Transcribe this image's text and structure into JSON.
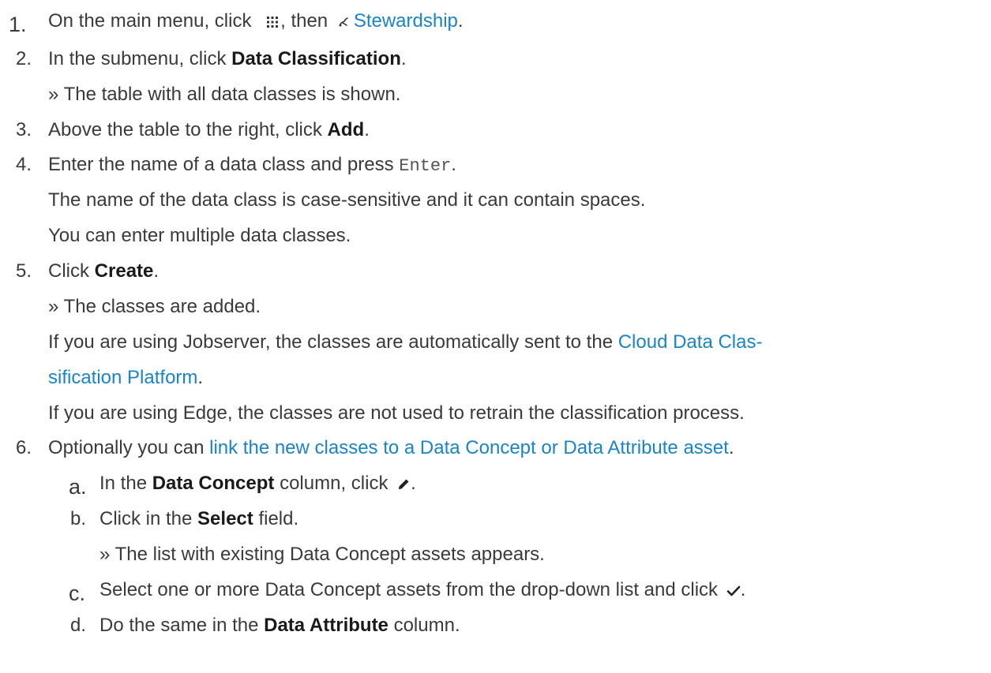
{
  "icons": {
    "menu": "grid-menu-icon",
    "stewardship": "stewardship-icon",
    "edit": "pencil-icon",
    "confirm": "checkmark-icon"
  },
  "colors": {
    "text": "#3a3a3a",
    "link": "#1a84c6"
  },
  "steps": {
    "s1": {
      "num": "1.",
      "t1": "On the main menu, click",
      "t2": ", then",
      "link": "Stewardship",
      "t3": "."
    },
    "s2": {
      "num": "2.",
      "t1": "In the submenu, click",
      "bold": "Data Classification",
      "t2": ".",
      "result": "» The table with all data classes is shown."
    },
    "s3": {
      "num": "3.",
      "t1": "Above the table to the right, click",
      "bold": "Add",
      "t2": "."
    },
    "s4": {
      "num": "4.",
      "t1": "Enter the name of a data class and press",
      "key": "Enter",
      "t2": ".",
      "p1": "The name of the data class is case-sensitive and it can contain spaces.",
      "p2": "You can enter multiple data classes."
    },
    "s5": {
      "num": "5.",
      "t1": "Click",
      "bold": "Create",
      "t2": ".",
      "result": "» The classes are added.",
      "p1_text": "If you are using Jobserver, the classes are automatically sent to the",
      "p1_link1": "Cloud Data Clas-",
      "p1_link2": "sification Platform",
      "p1_end": ".",
      "p2": "If you are using Edge, the classes are not used to retrain the classification process."
    },
    "s6": {
      "num": "6.",
      "t1": "Optionally you can",
      "link": "link the new classes to a Data Concept or Data Attribute asset",
      "t2": "."
    }
  },
  "substeps": {
    "a": {
      "num": "a.",
      "t1": "In the",
      "bold": "Data Concept",
      "t2": "column, click",
      "t3": "."
    },
    "b": {
      "num": "b.",
      "t1": "Click in the",
      "bold": "Select",
      "t2": "field.",
      "result": "» The list with existing Data Concept assets appears."
    },
    "c": {
      "num": "c.",
      "t1": "Select one or more Data Concept assets from the drop-down list and click",
      "t2": "."
    },
    "d": {
      "num": "d.",
      "t1": "Do the same in the",
      "bold": "Data Attribute",
      "t2": "column."
    }
  }
}
